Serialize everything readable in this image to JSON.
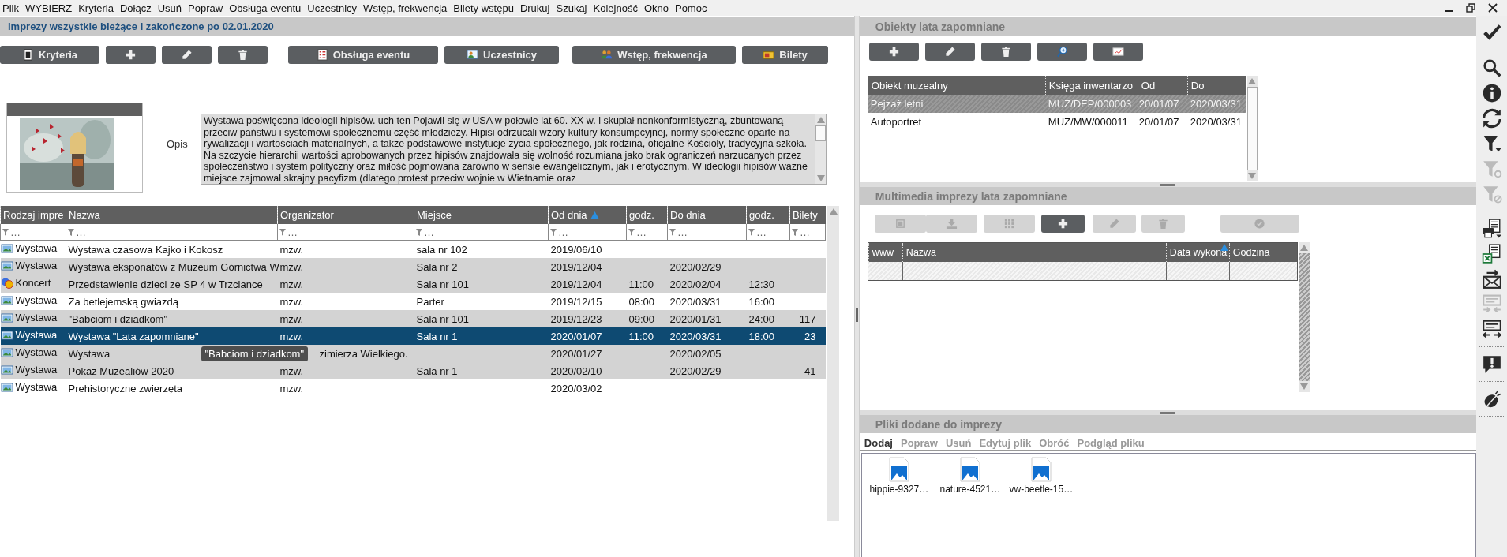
{
  "menu": [
    "Plik",
    "WYBIERZ",
    "Kryteria",
    "Dołącz",
    "Usuń",
    "Popraw",
    "Obsługa eventu",
    "Uczestnicy",
    "Wstęp, frekwencja",
    "Bilety wstępu",
    "Drukuj",
    "Szukaj",
    "Kolejność",
    "Okno",
    "Pomoc"
  ],
  "events": {
    "title": "Imprezy wszystkie bieżące i zakończone po 02.01.2020",
    "toolbar": [
      {
        "kind": "criteria",
        "label": "Kryteria"
      },
      {
        "kind": "plus"
      },
      {
        "kind": "pencil"
      },
      {
        "kind": "trash"
      },
      {
        "kind": "event",
        "label": "Obsługa eventu"
      },
      {
        "kind": "people",
        "label": "Uczestnicy"
      },
      {
        "kind": "group",
        "label": "Wstęp, frekwencja"
      },
      {
        "kind": "ticket",
        "label": "Bilety"
      }
    ],
    "description": {
      "label": "Opis",
      "text": "Wystawa poświęcona ideologii hipisów. uch ten Pojawił się w USA w połowie lat 60. XX w. i skupiał nonkonformistyczną, zbuntowaną przeciw państwu i systemowi społecznemu część młodzieży. Hipisi odrzucali wzory kultury konsumpcyjnej, normy społeczne oparte na rywalizacji i wartościach materialnych, a także podstawowe instytucje życia społecznego, jak rodzina, oficjalne Kościoły, tradycyjna szkoła. Na szczycie hierarchii wartości aprobowanych przez hipisów znajdowała się wolność rozumiana jako brak ograniczeń narzucanych przez społeczeństwo i system polityczny oraz miłość pojmowana zarówno w sensie ewangelicznym, jak i erotycznym. W ideologii hipisów ważne miejsce zajmował skrajny pacyfizm (dlatego protest przeciw wojnie w Wietnamie oraz"
    },
    "table": {
      "columns": [
        {
          "label": "Rodzaj impre",
          "filter": "…"
        },
        {
          "label": "Nazwa",
          "filter": "…"
        },
        {
          "label": "Organizator",
          "filter": "…"
        },
        {
          "label": "Miejsce",
          "filter": "…"
        },
        {
          "label": "Od dnia",
          "filter": "…",
          "sorted": true
        },
        {
          "label": "godz.",
          "filter": "…"
        },
        {
          "label": "Do dnia",
          "filter": "…"
        },
        {
          "label": "godz.",
          "filter": "…"
        },
        {
          "label": "Bilety",
          "filter": "…"
        }
      ],
      "rows": [
        {
          "kind": "exhibition",
          "type": "Wystawa",
          "name": "Wystawa czasowa Kajko i Kokosz",
          "organizer": "mzw.",
          "place": "sala nr 102",
          "from_date": "2019/06/10",
          "shaded": false,
          "selected": false
        },
        {
          "kind": "exhibition",
          "type": "Wystawa",
          "name": "Wystawa eksponatów z Muzeum Górnictwa W",
          "organizer": "mzw.",
          "place": "Sala nr 2",
          "from_date": "2019/12/04",
          "to_date": "2020/02/29",
          "shaded": true,
          "selected": false
        },
        {
          "kind": "concert",
          "type": "Koncert",
          "name": "Przedstawienie dzieci ze SP 4 w Trzciance",
          "organizer": "mzw.",
          "place": "Sala nr 101",
          "from_date": "2019/12/04",
          "from_time": "11:00",
          "to_date": "2020/02/04",
          "to_time": "12:30",
          "shaded": true,
          "selected": false
        },
        {
          "kind": "exhibition",
          "type": "Wystawa",
          "name": "Za betlejemską gwiazdą",
          "organizer": "mzw.",
          "place": "Parter",
          "from_date": "2019/12/15",
          "from_time": "08:00",
          "to_date": "2020/03/31",
          "to_time": "16:00",
          "shaded": false,
          "selected": false
        },
        {
          "kind": "exhibition",
          "type": "Wystawa",
          "name": "\"Babciom i dziadkom\"",
          "organizer": "mzw.",
          "place": "Sala nr 101",
          "from_date": "2019/12/23",
          "from_time": "09:00",
          "to_date": "2020/01/31",
          "to_time": "24:00",
          "tickets": "117",
          "shaded": true,
          "selected": false
        },
        {
          "kind": "exhibition",
          "type": "Wystawa",
          "name": "Wystawa \"Lata zapomniane\"",
          "organizer": "mzw.",
          "place": "Sala nr 1",
          "from_date": "2020/01/07",
          "from_time": "11:00",
          "to_date": "2020/03/31",
          "to_time": "18:00",
          "tickets": "23",
          "shaded": false,
          "selected": true
        },
        {
          "kind": "exhibition",
          "type": "Wystawa",
          "name": "Wystawa",
          "organizer": "zimierza Wielkiego.",
          "from_date": "2020/01/27",
          "to_date": "2020/02/05",
          "tooltip": "\"Babciom i dziadkom\"",
          "shaded": true,
          "selected": false
        },
        {
          "kind": "exhibition",
          "type": "Wystawa",
          "name": "Pokaz Muzealiów 2020",
          "organizer": "mzw.",
          "place": "Sala nr 1",
          "from_date": "2020/02/10",
          "to_date": "2020/02/29",
          "tickets": "41",
          "shaded": true,
          "selected": false
        },
        {
          "kind": "exhibition",
          "type": "Wystawa",
          "name": "Prehistoryczne zwierzęta",
          "organizer": "mzw.",
          "from_date": "2020/03/02",
          "shaded": false,
          "selected": false
        }
      ]
    }
  },
  "objects": {
    "title": "Obiekty lata zapomniane",
    "toolbar": [
      {
        "kind": "plus"
      },
      {
        "kind": "pencil"
      },
      {
        "kind": "trash"
      },
      {
        "kind": "zoom"
      },
      {
        "kind": "board"
      }
    ],
    "columns": [
      "Obiekt muzealny",
      "Księga inwentarzo",
      "Od",
      "Do"
    ],
    "rows": [
      {
        "cells": [
          "Pejzaż letni",
          "MUZ/DEP/000003",
          "20/01/07",
          "2020/03/31"
        ],
        "selected": true
      },
      {
        "cells": [
          "Autoportret",
          "MUZ/MW/000011",
          "20/01/07",
          "2020/03/31"
        ],
        "selected": false
      }
    ]
  },
  "multimedia": {
    "title": "Multimedia imprezy lata zapomniane",
    "toolbar": [
      {
        "kind": "square",
        "disabled": true
      },
      {
        "kind": "download",
        "disabled": true
      },
      {
        "kind": "grid",
        "disabled": true
      },
      {
        "kind": "plus",
        "disabled": false
      },
      {
        "kind": "pencil",
        "disabled": true
      },
      {
        "kind": "trash",
        "disabled": true
      },
      {
        "kind": "checkcircle",
        "disabled": true
      }
    ],
    "columns": [
      {
        "label": "www"
      },
      {
        "label": "Nazwa"
      },
      {
        "label": "Data wykona",
        "sorted": true
      },
      {
        "label": "Godzina"
      }
    ]
  },
  "files": {
    "title": "Pliki dodane do imprezy",
    "actions": [
      {
        "label": "Dodaj",
        "disabled": false
      },
      {
        "label": "Popraw",
        "disabled": true
      },
      {
        "label": "Usuń",
        "disabled": true
      },
      {
        "label": "Edytuj plik",
        "disabled": true
      },
      {
        "label": "Obróć",
        "disabled": true
      },
      {
        "label": "Podgląd pliku",
        "disabled": true
      }
    ],
    "items": [
      "hippie-9327…",
      "nature-4521…",
      "vw-beetle-15…"
    ]
  },
  "sidebar": [
    [
      {
        "kind": "check",
        "disabled": false
      }
    ],
    [
      {
        "kind": "search",
        "disabled": false
      },
      {
        "kind": "info",
        "disabled": false
      },
      {
        "kind": "refresh",
        "disabled": false
      },
      {
        "kind": "filter",
        "disabled": false
      },
      {
        "kind": "filterRefresh",
        "disabled": true
      },
      {
        "kind": "filterClear",
        "disabled": true
      }
    ],
    [
      {
        "kind": "print",
        "disabled": false
      },
      {
        "kind": "excel",
        "disabled": false
      },
      {
        "kind": "mail",
        "disabled": false
      },
      {
        "kind": "textSwap",
        "disabled": true
      },
      {
        "kind": "textSwap2",
        "disabled": false
      }
    ],
    [
      {
        "kind": "alert",
        "disabled": false
      }
    ],
    [
      {
        "kind": "bug",
        "disabled": false
      }
    ]
  ]
}
